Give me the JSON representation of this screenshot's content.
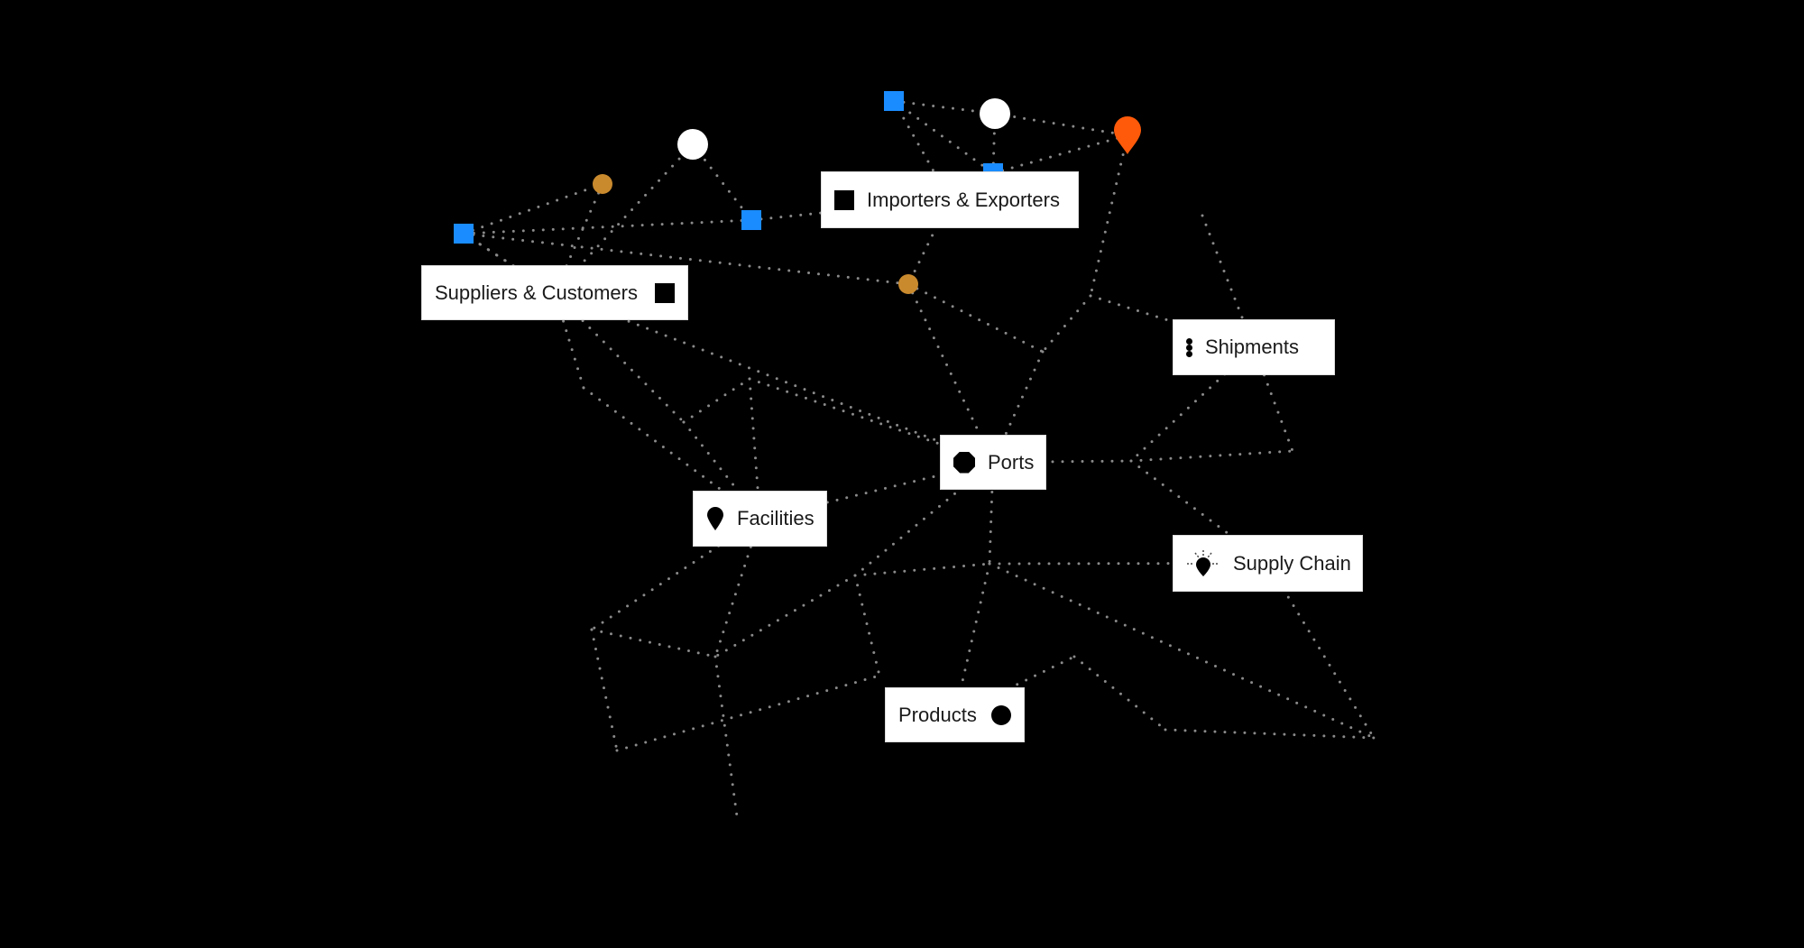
{
  "colors": {
    "background": "#000000",
    "edge": "#8a8a8a",
    "blue_square": "#1a8cff",
    "white_node": "#ffffff",
    "gold_node": "#c98a2e",
    "orange_pin": "#ff5a0a",
    "indigo_dome": "#2f4fbf",
    "label_bg": "#ffffff",
    "label_text": "#1a1a1a"
  },
  "labels": {
    "importers": {
      "text": "Importers & Exporters",
      "icon": "square-icon"
    },
    "suppliers": {
      "text": "Suppliers & Customers",
      "icon": "square-icon"
    },
    "shipments": {
      "text": "Shipments",
      "icon": "ellipsis-icon"
    },
    "ports": {
      "text": "Ports",
      "icon": "octagon-icon"
    },
    "facilities": {
      "text": "Facilities",
      "icon": "map-pin-icon"
    },
    "supply_chain": {
      "text": "Supply Chain",
      "icon": "lightbulb-icon"
    },
    "products": {
      "text": "Products",
      "icon": "circle-icon"
    }
  },
  "nodes": [
    {
      "id": "b1",
      "type": "blue-square"
    },
    {
      "id": "w1",
      "type": "white-circle"
    },
    {
      "id": "o1",
      "type": "orange-pin"
    },
    {
      "id": "b2",
      "type": "blue-square"
    },
    {
      "id": "w2",
      "type": "white-circle"
    },
    {
      "id": "g1",
      "type": "gold-circle"
    },
    {
      "id": "b3",
      "type": "blue-square"
    },
    {
      "id": "b4",
      "type": "blue-square"
    },
    {
      "id": "g2",
      "type": "gold-circle"
    },
    {
      "id": "g3",
      "type": "gold-circle"
    },
    {
      "id": "d1",
      "type": "indigo-dome"
    },
    {
      "id": "o2",
      "type": "orange-pin-small"
    },
    {
      "id": "o3",
      "type": "orange-pin"
    },
    {
      "id": "o4",
      "type": "orange-pin"
    },
    {
      "id": "g4",
      "type": "gold-circle"
    },
    {
      "id": "b5",
      "type": "blue-square-large"
    },
    {
      "id": "w3",
      "type": "white-circle"
    },
    {
      "id": "w4",
      "type": "white-circle"
    },
    {
      "id": "o5",
      "type": "orange-pin-small"
    },
    {
      "id": "w5",
      "type": "white-circle-small"
    },
    {
      "id": "o6",
      "type": "orange-pin"
    },
    {
      "id": "d2",
      "type": "indigo-dome"
    },
    {
      "id": "o7",
      "type": "orange-pin-small"
    },
    {
      "id": "w6",
      "type": "white-circle-small"
    },
    {
      "id": "o8",
      "type": "orange-pin-small"
    },
    {
      "id": "d3",
      "type": "indigo-dome"
    },
    {
      "id": "b6",
      "type": "blue-square"
    },
    {
      "id": "g5",
      "type": "gold-circle"
    }
  ],
  "edges": [
    [
      "b1",
      "w1"
    ],
    [
      "b1",
      "b2"
    ],
    [
      "w1",
      "b2"
    ],
    [
      "w1",
      "o1"
    ],
    [
      "b2",
      "o1"
    ],
    [
      "b1",
      "L_imp"
    ],
    [
      "b4",
      "g1"
    ],
    [
      "b4",
      "L_sup"
    ],
    [
      "g1",
      "L_sup"
    ],
    [
      "w2",
      "L_sup"
    ],
    [
      "w2",
      "b3"
    ],
    [
      "b3",
      "L_imp"
    ],
    [
      "b3",
      "b4"
    ],
    [
      "L_sup",
      "b4"
    ],
    [
      "b4",
      "g2"
    ],
    [
      "L_imp",
      "g2"
    ],
    [
      "g2",
      "o2"
    ],
    [
      "g2",
      "L_ports"
    ],
    [
      "o1",
      "d1"
    ],
    [
      "d1",
      "o2"
    ],
    [
      "d1",
      "L_ship"
    ],
    [
      "o2",
      "L_ports"
    ],
    [
      "g5",
      "L_ship"
    ],
    [
      "L_ship",
      "b5"
    ],
    [
      "L_ship",
      "w3"
    ],
    [
      "L_sup",
      "o3"
    ],
    [
      "L_sup",
      "g4"
    ],
    [
      "L_sup",
      "L_ports"
    ],
    [
      "o3",
      "L_fac"
    ],
    [
      "g4",
      "o4"
    ],
    [
      "g4",
      "L_fac"
    ],
    [
      "o4",
      "L_fac"
    ],
    [
      "o4",
      "L_ports"
    ],
    [
      "L_ports",
      "b5"
    ],
    [
      "b5",
      "w3"
    ],
    [
      "b5",
      "L_sc"
    ],
    [
      "L_fac",
      "L_ports"
    ],
    [
      "L_fac",
      "w5"
    ],
    [
      "L_fac",
      "o6"
    ],
    [
      "L_ports",
      "o5"
    ],
    [
      "L_ports",
      "w4"
    ],
    [
      "o5",
      "w4"
    ],
    [
      "o5",
      "o6"
    ],
    [
      "o5",
      "d2"
    ],
    [
      "w4",
      "L_sc"
    ],
    [
      "w4",
      "L_prod"
    ],
    [
      "w4",
      "b6"
    ],
    [
      "w5",
      "o6"
    ],
    [
      "w5",
      "o8"
    ],
    [
      "o6",
      "w6"
    ],
    [
      "o8",
      "d2"
    ],
    [
      "L_prod",
      "o7"
    ],
    [
      "o7",
      "d3"
    ],
    [
      "d3",
      "b6"
    ],
    [
      "L_sc",
      "b6"
    ]
  ]
}
